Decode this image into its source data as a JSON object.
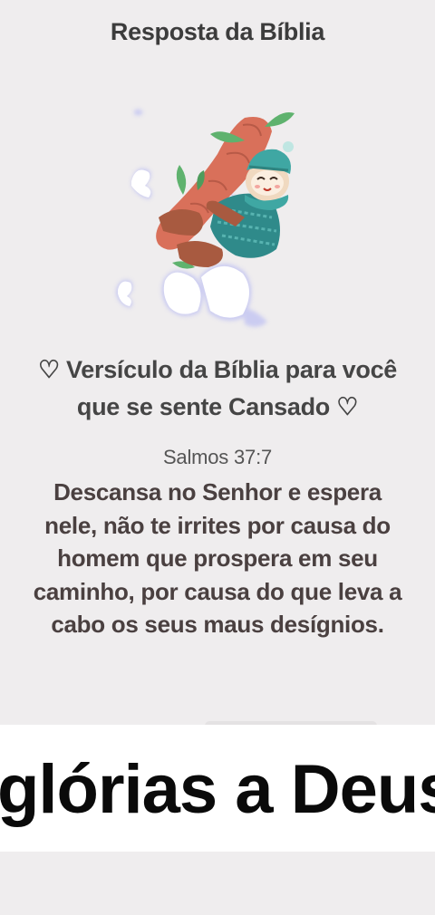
{
  "app": {
    "title": "Resposta da Bíblia"
  },
  "illustration": {
    "icon": "sloth-hugging-tree-icon"
  },
  "content": {
    "heading": "♡ Versículo da Bíblia para você que se sente Cansado ♡",
    "reference": "Salmos 37:7",
    "verse": "Descansa no Senhor e espera nele, não te irrites por causa do homem que prospera em seu caminho, por causa do que leva a cabo os seus maus desígnios."
  },
  "overlay": {
    "caption": "glórias a Deus"
  },
  "colors": {
    "background": "#efedee",
    "title": "#3c3c3c",
    "verse": "#4a4040",
    "overlay_background": "#ffffff",
    "overlay_text": "#0a0a0a"
  }
}
